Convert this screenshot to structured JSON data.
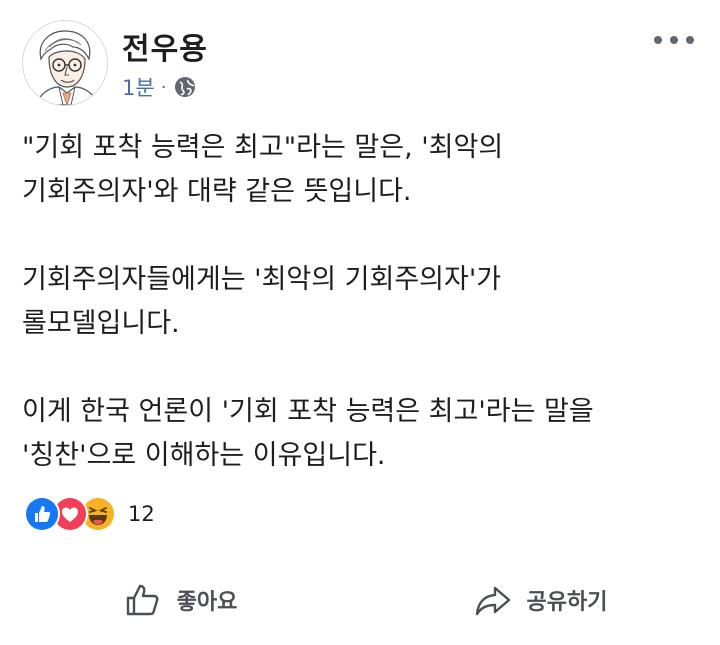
{
  "post": {
    "author": {
      "name": "전우용"
    },
    "meta": {
      "time": "1분",
      "separator": "·",
      "audience_icon": "globe-icon"
    },
    "more_icon": "more-horizontal-icon",
    "paragraphs": [
      "\"기회 포착 능력은 최고\"라는 말은, '최악의\n기회주의자'와 대략 같은 뜻입니다.",
      "기회주의자들에게는 '최악의 기회주의자'가\n롤모델입니다.",
      "이게 한국 언론이 '기회 포착 능력은 최고'라는 말을\n'칭찬'으로 이해하는 이유입니다."
    ],
    "reactions": {
      "types": [
        "like-reaction-icon",
        "love-reaction-icon",
        "haha-reaction-icon"
      ],
      "count": "12"
    },
    "actions": {
      "like_label": "좋아요",
      "share_label": "공유하기"
    },
    "colors": {
      "link": "#4b6fa8",
      "like_blue": "#1877f2",
      "love_red": "#f33e58",
      "haha_yellow": "#f7b125",
      "text": "#1c1e21",
      "muted": "#606770"
    }
  }
}
